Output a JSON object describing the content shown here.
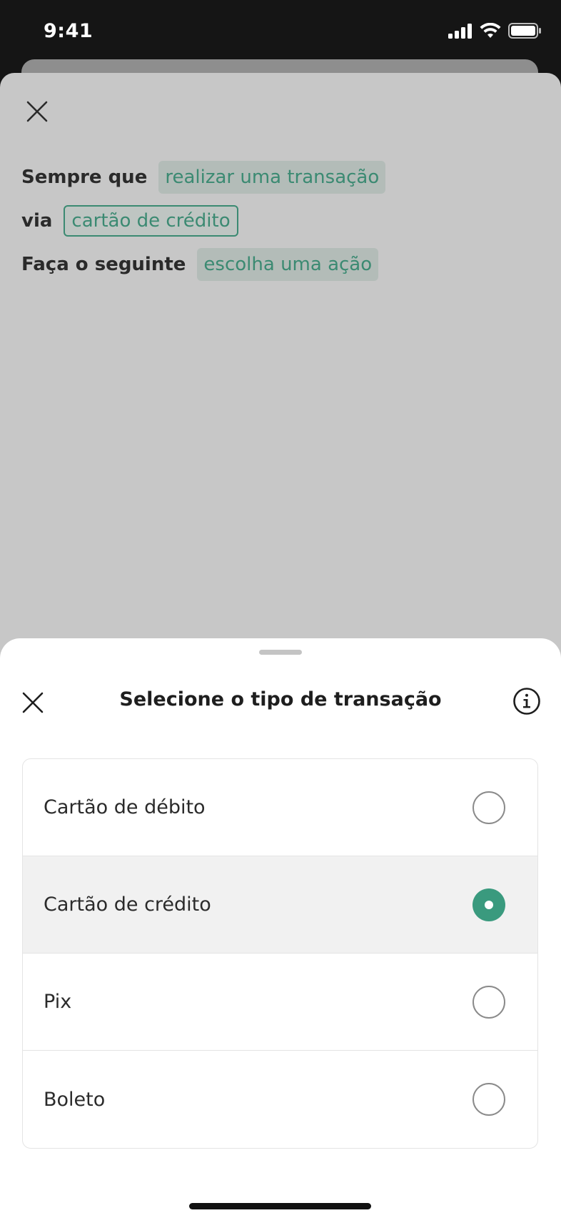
{
  "status_bar": {
    "time": "9:41",
    "icons": [
      "cellular-signal-icon",
      "wifi-icon",
      "battery-icon"
    ]
  },
  "rule_builder": {
    "close_icon": "close-icon",
    "line1": {
      "label": "Sempre que",
      "chip": "realizar uma transação"
    },
    "line2": {
      "label": "via",
      "chip": "cartão de crédito"
    },
    "line3": {
      "label": "Faça o seguinte",
      "chip": "escolha uma ação"
    }
  },
  "bottom_sheet": {
    "title": "Selecione o tipo de transação",
    "close_icon": "close-icon",
    "info_icon": "info-icon",
    "options": [
      {
        "label": "Cartão de débito",
        "selected": false
      },
      {
        "label": "Cartão de crédito",
        "selected": true
      },
      {
        "label": "Pix",
        "selected": false
      },
      {
        "label": "Boleto",
        "selected": false
      }
    ]
  },
  "colors": {
    "accent": "#3a9a7e",
    "chip_text": "#3b8a72",
    "dim_background": "#c7c7c7"
  }
}
